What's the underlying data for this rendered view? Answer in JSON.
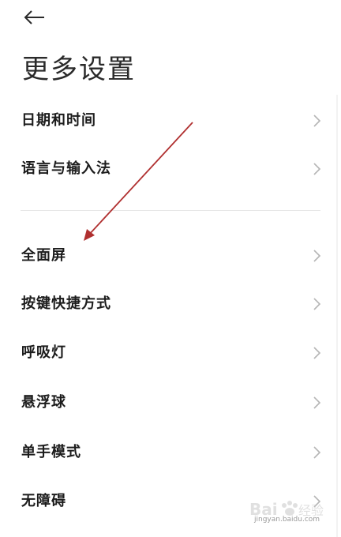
{
  "header": {
    "title": "更多设置"
  },
  "settings": {
    "group1": [
      {
        "label": "日期和时间"
      },
      {
        "label": "语言与输入法"
      }
    ],
    "group2": [
      {
        "label": "全面屏"
      },
      {
        "label": "按键快捷方式"
      },
      {
        "label": "呼吸灯"
      },
      {
        "label": "悬浮球"
      },
      {
        "label": "单手模式"
      },
      {
        "label": "无障碍"
      }
    ]
  },
  "watermark": {
    "text": "jingyan.baidu.com"
  },
  "colors": {
    "annotation_arrow": "#b03030",
    "chevron": "#b5b5b5",
    "divider": "#e6e6e6"
  }
}
